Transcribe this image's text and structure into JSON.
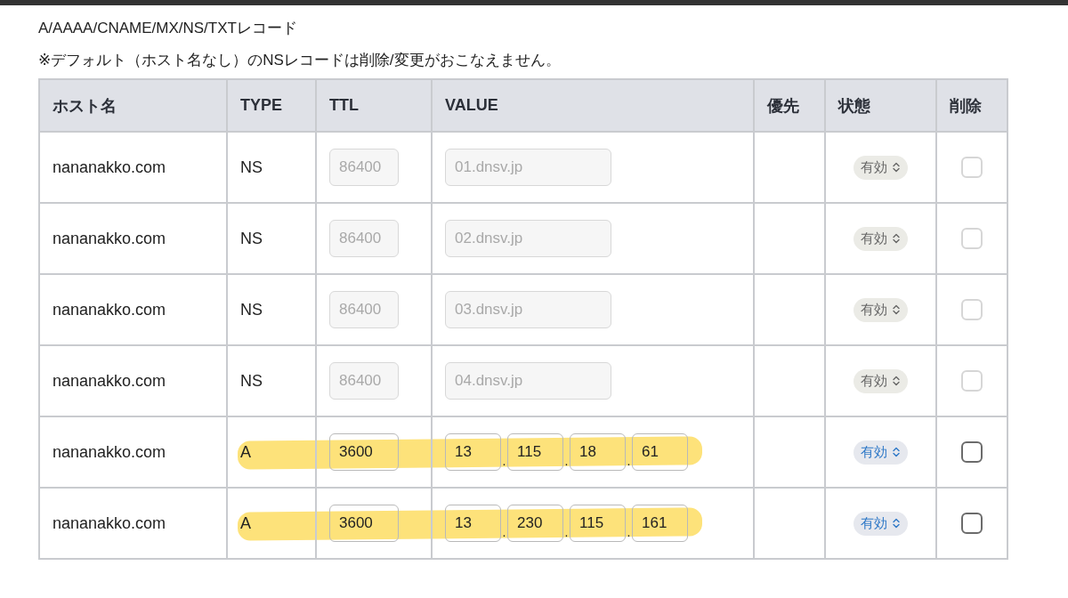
{
  "title": "A/AAAA/CNAME/MX/NS/TXTレコード",
  "note": "※デフォルト（ホスト名なし）のNSレコードは削除/変更がおこなえません。",
  "table": {
    "columns": [
      "ホスト名",
      "TYPE",
      "TTL",
      "VALUE",
      "優先",
      "状態",
      "削除"
    ],
    "rows": [
      {
        "host": "nananakko.com",
        "type": "NS",
        "ttl": "86400",
        "kind": "text",
        "value": [
          "01.dnsv.jp"
        ],
        "status": "有効",
        "disabled": true,
        "highlighted": false,
        "checked": false
      },
      {
        "host": "nananakko.com",
        "type": "NS",
        "ttl": "86400",
        "kind": "text",
        "value": [
          "02.dnsv.jp"
        ],
        "status": "有効",
        "disabled": true,
        "highlighted": false,
        "checked": false
      },
      {
        "host": "nananakko.com",
        "type": "NS",
        "ttl": "86400",
        "kind": "text",
        "value": [
          "03.dnsv.jp"
        ],
        "status": "有効",
        "disabled": true,
        "highlighted": false,
        "checked": false
      },
      {
        "host": "nananakko.com",
        "type": "NS",
        "ttl": "86400",
        "kind": "text",
        "value": [
          "04.dnsv.jp"
        ],
        "status": "有効",
        "disabled": true,
        "highlighted": false,
        "checked": false
      },
      {
        "host": "nananakko.com",
        "type": "A",
        "ttl": "3600",
        "kind": "ipv4",
        "separator": ".",
        "value": [
          "13",
          "115",
          "18",
          "61"
        ],
        "status": "有効",
        "disabled": false,
        "highlighted": true,
        "checked": false
      },
      {
        "host": "nananakko.com",
        "type": "A",
        "ttl": "3600",
        "kind": "ipv4",
        "separator": ".",
        "value": [
          "13",
          "230",
          "115",
          "161"
        ],
        "status": "有効",
        "disabled": false,
        "highlighted": true,
        "checked": false
      }
    ]
  }
}
